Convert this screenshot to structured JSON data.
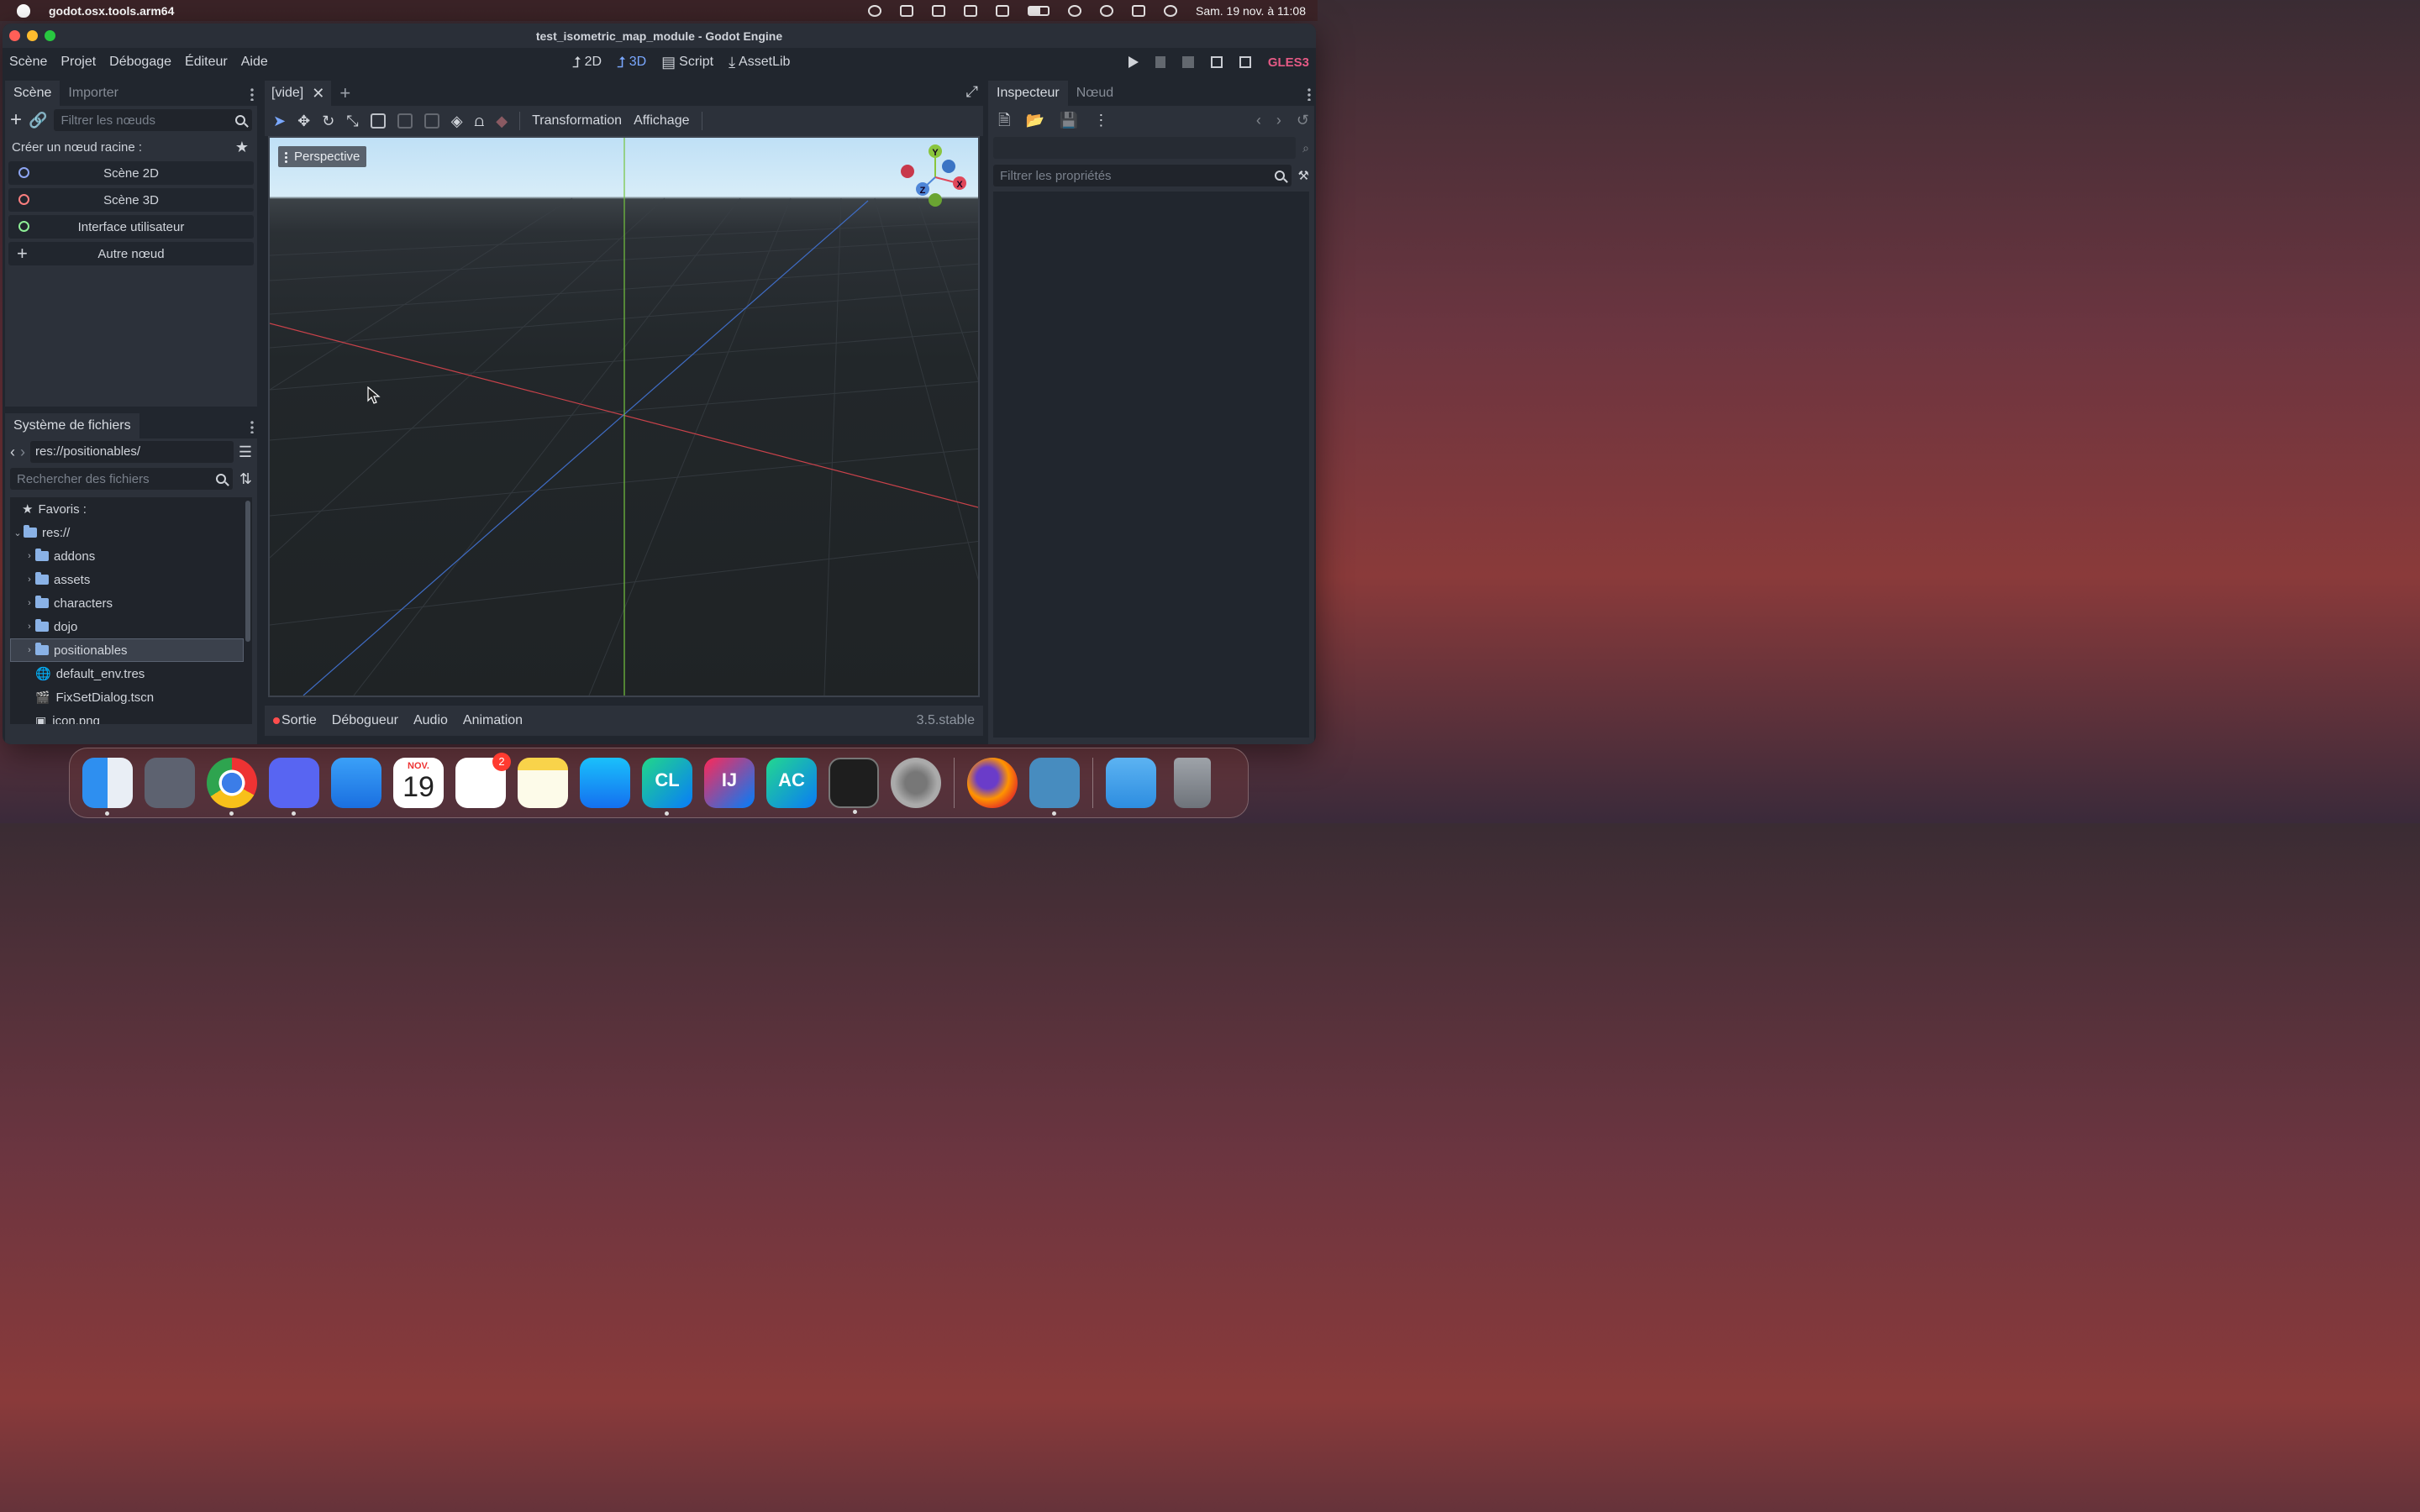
{
  "menubar": {
    "app_name": "godot.osx.tools.arm64",
    "clock": "Sam. 19 nov. à 11:08"
  },
  "window": {
    "title": "test_isometric_map_module - Godot Engine"
  },
  "main_menu": {
    "items": [
      "Scène",
      "Projet",
      "Débogage",
      "Éditeur",
      "Aide"
    ],
    "modes": [
      "2D",
      "3D",
      "Script",
      "AssetLib"
    ],
    "active_mode": "3D",
    "renderer": "GLES3"
  },
  "scene_panel": {
    "tabs": [
      "Scène",
      "Importer"
    ],
    "filter_placeholder": "Filtrer les nœuds",
    "root_label": "Créer un nœud racine :",
    "root_buttons": [
      {
        "label": "Scène 2D",
        "color": "#8da5f3"
      },
      {
        "label": "Scène 3D",
        "color": "#fc7f7f"
      },
      {
        "label": "Interface utilisateur",
        "color": "#8eef97"
      },
      {
        "label": "Autre nœud",
        "color": "#d0d4db"
      }
    ]
  },
  "filesystem": {
    "tab": "Système de fichiers",
    "path": "res://positionables/",
    "search_placeholder": "Rechercher des fichiers",
    "items": [
      {
        "label": "Favoris :",
        "kind": "star"
      },
      {
        "label": "res://",
        "kind": "folder-open"
      },
      {
        "label": "addons",
        "kind": "folder"
      },
      {
        "label": "assets",
        "kind": "folder"
      },
      {
        "label": "characters",
        "kind": "folder"
      },
      {
        "label": "dojo",
        "kind": "folder"
      },
      {
        "label": "positionables",
        "kind": "folder",
        "selected": true
      },
      {
        "label": "default_env.tres",
        "kind": "resource"
      },
      {
        "label": "FixSetDialog.tscn",
        "kind": "scene"
      },
      {
        "label": "icon.png",
        "kind": "image"
      }
    ]
  },
  "editor": {
    "tab_label": "[vide]",
    "toolbar_menus": [
      "Transformation",
      "Affichage"
    ],
    "viewport_label": "Perspective",
    "gizmo_axes": [
      "Y",
      "X",
      "Z"
    ]
  },
  "bottom_panel": {
    "tabs": [
      "Sortie",
      "Débogueur",
      "Audio",
      "Animation"
    ],
    "version": "3.5.stable"
  },
  "inspector": {
    "tabs": [
      "Inspecteur",
      "Nœud"
    ],
    "filter_placeholder": "Filtrer les propriétés"
  },
  "dock": {
    "apps": [
      "Finder",
      "Launchpad",
      "Chrome",
      "Discord",
      "Mail",
      "Calendrier",
      "Rappels",
      "Notes",
      "App Store",
      "CLion",
      "IntelliJ IDEA",
      "AppCode",
      "Terminal",
      "Réglages",
      "Firefox",
      "Godot",
      "Dossier",
      "Corbeille"
    ],
    "calendar_month": "NOV.",
    "calendar_day": "19",
    "reminders_badge": "2"
  }
}
